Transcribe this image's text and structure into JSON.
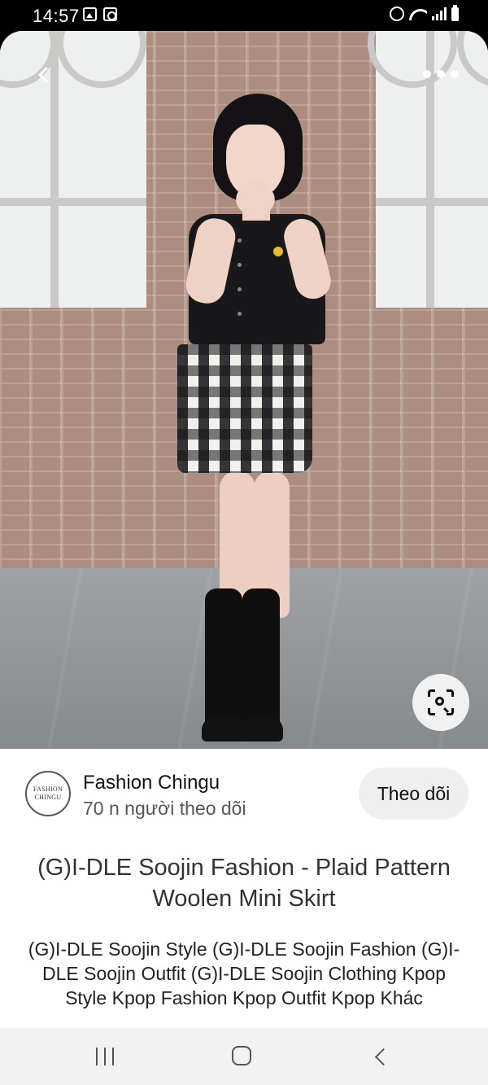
{
  "status_bar": {
    "time": "14:57",
    "left_icons": [
      "gallery-icon",
      "screen-record-icon"
    ],
    "right_icons": [
      "alarm-icon",
      "wifi-icon",
      "signal-icon",
      "battery-icon"
    ]
  },
  "pin": {
    "image_icons": {
      "back": "chevron-left-icon",
      "more": "more-horizontal-icon",
      "visual_search": "lens-search-icon"
    },
    "creator": {
      "avatar_text_line1": "FASHION",
      "avatar_text_line2": "CHINGU",
      "name": "Fashion Chingu",
      "followers": "70 n người theo dõi",
      "follow_label": "Theo dõi"
    },
    "title": "(G)I-DLE Soojin Fashion - Plaid Pattern Woolen Mini Skirt",
    "description": "(G)I-DLE Soojin Style (G)I-DLE Soojin Fashion (G)I-DLE Soojin Outfit (G)I-DLE Soojin Clothing Kpop Style Kpop Fashion Kpop Outfit Kpop Khác"
  },
  "nav_bar": {
    "icons": [
      "recent-apps-icon",
      "home-icon",
      "back-icon"
    ]
  },
  "colors": {
    "follow_button_bg": "#efefef",
    "nav_bar_bg": "#f2f2f2",
    "status_bar_bg": "#000000"
  }
}
